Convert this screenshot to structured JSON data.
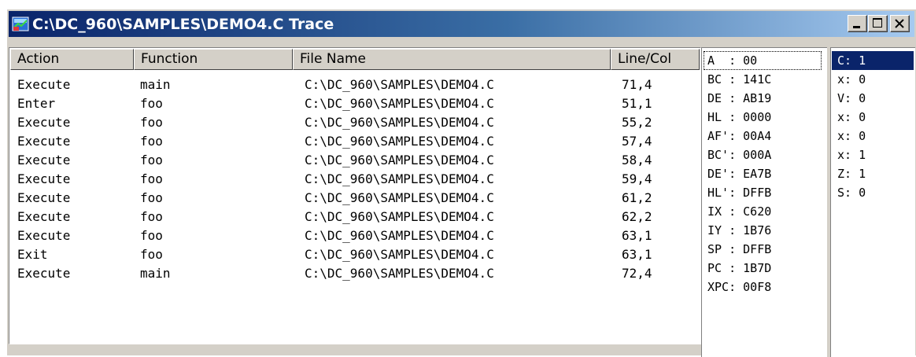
{
  "window": {
    "title": "C:\\DC_960\\SAMPLES\\DEMO4.C Trace",
    "icon": "trace-window-icon",
    "caption_buttons": [
      "minimize-icon",
      "maximize-icon",
      "close-icon"
    ]
  },
  "trace": {
    "columns": [
      "Action",
      "Function",
      "File Name",
      "Line/Col"
    ],
    "rows": [
      {
        "action": "Execute",
        "function": "main",
        "file": "C:\\DC_960\\SAMPLES\\DEMO4.C",
        "linecol": "71,4"
      },
      {
        "action": "Enter",
        "function": "foo",
        "file": "C:\\DC_960\\SAMPLES\\DEMO4.C",
        "linecol": "51,1"
      },
      {
        "action": "Execute",
        "function": "foo",
        "file": "C:\\DC_960\\SAMPLES\\DEMO4.C",
        "linecol": "55,2"
      },
      {
        "action": "Execute",
        "function": "foo",
        "file": "C:\\DC_960\\SAMPLES\\DEMO4.C",
        "linecol": "57,4"
      },
      {
        "action": "Execute",
        "function": "foo",
        "file": "C:\\DC_960\\SAMPLES\\DEMO4.C",
        "linecol": "58,4"
      },
      {
        "action": "Execute",
        "function": "foo",
        "file": "C:\\DC_960\\SAMPLES\\DEMO4.C",
        "linecol": "59,4"
      },
      {
        "action": "Execute",
        "function": "foo",
        "file": "C:\\DC_960\\SAMPLES\\DEMO4.C",
        "linecol": "61,2"
      },
      {
        "action": "Execute",
        "function": "foo",
        "file": "C:\\DC_960\\SAMPLES\\DEMO4.C",
        "linecol": "62,2"
      },
      {
        "action": "Execute",
        "function": "foo",
        "file": "C:\\DC_960\\SAMPLES\\DEMO4.C",
        "linecol": "63,1"
      },
      {
        "action": "Exit",
        "function": "foo",
        "file": "C:\\DC_960\\SAMPLES\\DEMO4.C",
        "linecol": "63,1"
      },
      {
        "action": "Execute",
        "function": "main",
        "file": "C:\\DC_960\\SAMPLES\\DEMO4.C",
        "linecol": "72,4"
      }
    ]
  },
  "registers": [
    "A  : 00",
    "BC : 141C",
    "DE : AB19",
    "HL : 0000",
    "AF': 00A4",
    "BC': 000A",
    "DE': EA7B",
    "HL': DFFB",
    "IX : C620",
    "IY : 1B76",
    "SP : DFFB",
    "PC : 1B7D",
    "XPC: 00F8"
  ],
  "flags": [
    "C: 1",
    "x: 0",
    "V: 0",
    "x: 0",
    "x: 0",
    "x: 1",
    "Z: 1",
    "S: 0"
  ],
  "colors": {
    "title_bar_start": "#0a246a",
    "title_bar_end": "#a6caf0",
    "selection": "#0a246a",
    "chrome": "#d4d0c8"
  }
}
